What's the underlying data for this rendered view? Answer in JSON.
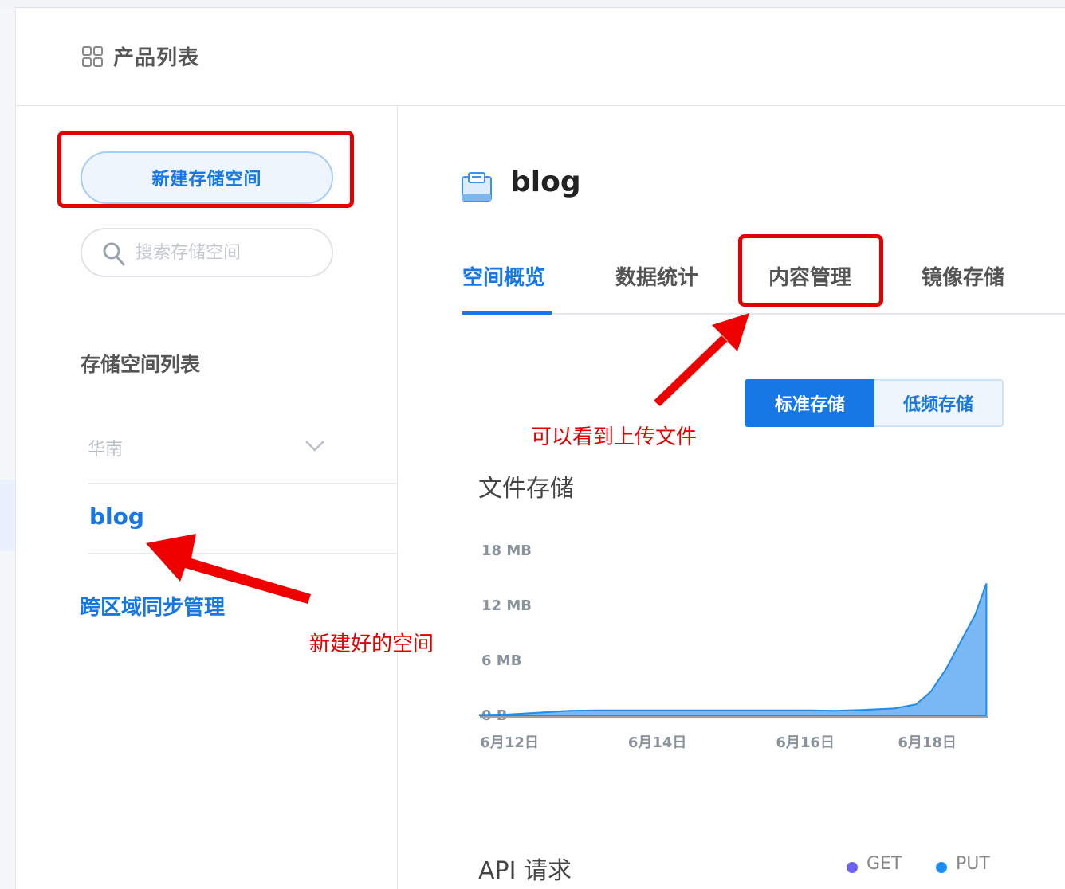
{
  "header": {
    "title": "产品列表",
    "icon": "grid-icon"
  },
  "sidebar": {
    "new_bucket_button": "新建存储空间",
    "search_placeholder": "搜索存储空间",
    "list_title": "存储空间列表",
    "region": "华南",
    "buckets": [
      {
        "label": "blog"
      }
    ],
    "cross_region_sync": "跨区域同步管理"
  },
  "main": {
    "bucket_name": "blog",
    "tabs": [
      {
        "label": "空间概览",
        "active": true
      },
      {
        "label": "数据统计",
        "active": false
      },
      {
        "label": "内容管理",
        "active": false
      },
      {
        "label": "镜像存储",
        "active": false
      }
    ],
    "storage_class_toggle": [
      {
        "label": "标准存储",
        "active": true
      },
      {
        "label": "低频存储",
        "active": false
      }
    ],
    "file_storage_title": "文件存储",
    "api_title": "API 请求",
    "api_legend": [
      {
        "label": "GET",
        "color": "#6c63f0"
      },
      {
        "label": "PUT",
        "color": "#1d8cf0"
      }
    ]
  },
  "annotations": {
    "new_bucket_note": "新建好的空间",
    "content_mgmt_note": "可以看到上传文件"
  },
  "colors": {
    "accent": "#1677e5",
    "annotation": "#e30000",
    "area_fill": "#7ab8f5"
  },
  "chart_data": {
    "type": "area",
    "x_ticks": [
      "6月12日",
      "6月14日",
      "6月16日",
      "6月18日"
    ],
    "y_ticks": [
      "0 B",
      "6 MB",
      "12 MB",
      "18 MB"
    ],
    "ylim_mb": [
      0,
      18
    ],
    "x_range_days": [
      11.6,
      18.5
    ],
    "points": [
      [
        11.6,
        0.05
      ],
      [
        12.0,
        0.1
      ],
      [
        12.4,
        0.3
      ],
      [
        12.8,
        0.5
      ],
      [
        13.2,
        0.55
      ],
      [
        13.6,
        0.55
      ],
      [
        14.0,
        0.55
      ],
      [
        14.5,
        0.55
      ],
      [
        15.0,
        0.55
      ],
      [
        15.5,
        0.55
      ],
      [
        16.0,
        0.55
      ],
      [
        16.4,
        0.5
      ],
      [
        16.8,
        0.6
      ],
      [
        17.2,
        0.75
      ],
      [
        17.5,
        1.2
      ],
      [
        17.7,
        2.6
      ],
      [
        17.9,
        5.0
      ],
      [
        18.1,
        8.0
      ],
      [
        18.3,
        11.0
      ],
      [
        18.45,
        14.4
      ]
    ]
  }
}
